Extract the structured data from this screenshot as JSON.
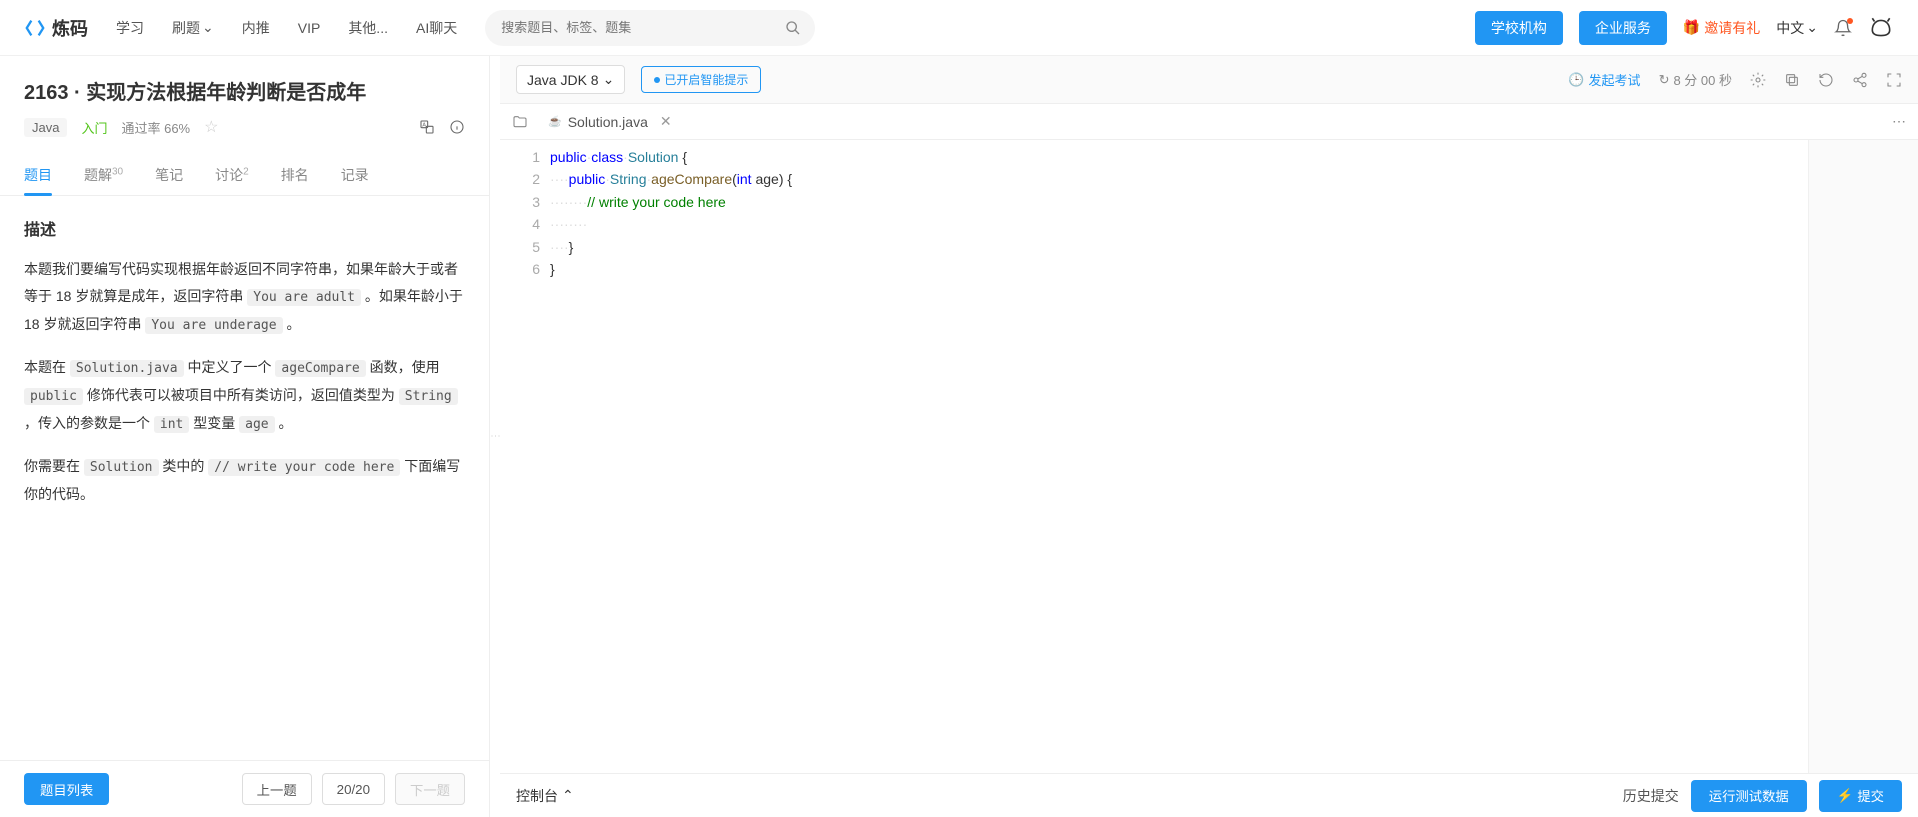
{
  "brand": "炼码",
  "nav": {
    "study": "学习",
    "practice": "刷题",
    "referral": "内推",
    "vip": "VIP",
    "other": "其他...",
    "ai_chat": "AI聊天"
  },
  "search": {
    "placeholder": "搜索题目、标签、题集"
  },
  "buttons": {
    "school": "学校机构",
    "enterprise": "企业服务"
  },
  "invite": "邀请有礼",
  "lang": "中文",
  "problem": {
    "id_title": "2163 · 实现方法根据年龄判断是否成年",
    "lang_tag": "Java",
    "level": "入门",
    "pass_label": "通过率 66%",
    "tabs": {
      "desc": "题目",
      "sol": "题解",
      "sol_sup": "30",
      "notes": "笔记",
      "discuss": "讨论",
      "discuss_sup": "2",
      "rank": "排名",
      "record": "记录"
    },
    "section_title": "描述",
    "p1_a": "本题我们要编写代码实现根据年龄返回不同字符串，如果年龄大于或者等于 18 岁就算是成年，返回字符串 ",
    "p1_code1": "You are adult",
    "p1_b": " 。如果年龄小于 18 岁就返回字符串 ",
    "p1_code2": "You are underage",
    "p1_c": " 。",
    "p2_a": "本题在 ",
    "p2_c1": "Solution.java",
    "p2_b": " 中定义了一个 ",
    "p2_c2": "ageCompare",
    "p2_c": " 函数，使用 ",
    "p2_c3": "public",
    "p2_d": " 修饰代表可以被项目中所有类访问，返回值类型为 ",
    "p2_c4": "String",
    "p2_e": " ，传入的参数是一个 ",
    "p2_c5": "int",
    "p2_f": " 型变量 ",
    "p2_c6": "age",
    "p2_g": " 。",
    "p3_a": "你需要在 ",
    "p3_c1": "Solution",
    "p3_b": " 类中的 ",
    "p3_c2": "// write your code here",
    "p3_c": " 下面编写你的代码。"
  },
  "bottom_left": {
    "list": "题目列表",
    "prev": "上一题",
    "counter": "20/20",
    "next": "下一题"
  },
  "editor": {
    "lang_sel": "Java JDK 8",
    "hint": "已开启智能提示",
    "exam": "发起考试",
    "timer": "8 分 00 秒",
    "filename": "Solution.java",
    "lines": [
      "1",
      "2",
      "3",
      "4",
      "5",
      "6"
    ],
    "code": {
      "l1": {
        "kw1": "public",
        "kw2": "class",
        "cls": "Solution",
        "end": " {"
      },
      "l2": {
        "kw1": "public",
        "type": "String",
        "fn": "ageCompare",
        "sig1": "(",
        "kw2": "int",
        "sig2": " age) {"
      },
      "l3": {
        "cmt": "// write your code here"
      },
      "l4": "",
      "l5": "    }",
      "l6": "}"
    }
  },
  "bottom_right": {
    "console": "控制台",
    "history": "历史提交",
    "run": "运行测试数据",
    "submit": "提交"
  }
}
